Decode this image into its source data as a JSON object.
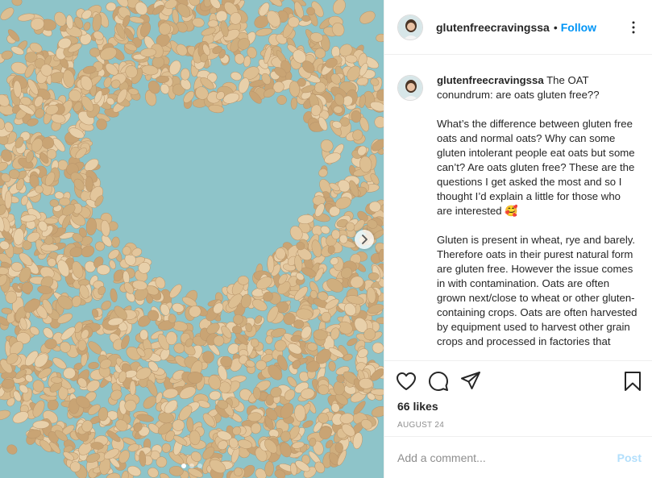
{
  "post": {
    "username": "glutenfreecravingssa",
    "follow_label": "Follow",
    "separator": "•"
  },
  "caption": {
    "username": "glutenfreecravingssa",
    "text": " The OAT conundrum: are oats gluten free??\n\nWhat’s the difference between gluten free oats and normal oats? Why can some gluten intolerant people eat oats but some can’t? Are oats gluten free? These are the questions I get asked the most and so I thought I’d explain a little for those who are interested 🥰\n\nGluten is present in wheat, rye and barely. Therefore oats in their purest natural form are gluten free. However the issue comes in with contamination. Oats are often grown next/close to wheat or other gluten-containing crops. Oats are often harvested by equipment used to harvest other grain crops and processed in factories that"
  },
  "actions": {
    "likes": "66 likes",
    "date": "AUGUST 24"
  },
  "comment": {
    "placeholder": "Add a comment...",
    "post_label": "Post"
  },
  "carousel": {
    "slide_count": 3,
    "active_index": 0
  },
  "colors": {
    "follow": "#0095f6",
    "post_disabled": "#b2dffc",
    "photo_background": "#8ec4c9",
    "oat": "#d9b98a"
  },
  "icons": {
    "like": "heart-icon",
    "comment": "comment-icon",
    "share": "paper-plane-icon",
    "save": "bookmark-icon",
    "next": "chevron-right-icon",
    "more": "more-dots-icon"
  }
}
